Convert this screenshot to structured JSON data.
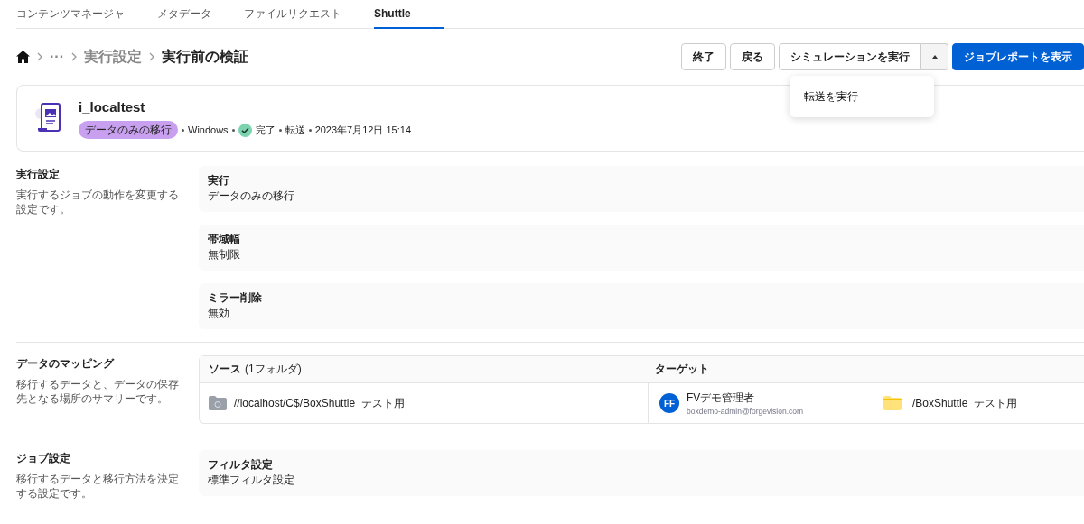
{
  "tabs": [
    {
      "label": "コンテンツマネージャ",
      "selected": false
    },
    {
      "label": "メタデータ",
      "selected": false
    },
    {
      "label": "ファイルリクエスト",
      "selected": false
    },
    {
      "label": "Shuttle",
      "selected": true
    }
  ],
  "breadcrumb": {
    "ellipsis": "···",
    "items": [
      "実行設定",
      "実行前の検証"
    ]
  },
  "actions": [
    {
      "label": "終了",
      "kind": "outline"
    },
    {
      "label": "戻る",
      "kind": "outline"
    },
    {
      "label": "シミュレーションを実行",
      "kind": "split"
    },
    {
      "label": "ジョブレポートを表示",
      "kind": "primary"
    }
  ],
  "dropdown": {
    "expanded": true,
    "items": [
      "転送を実行"
    ]
  },
  "job": {
    "name": "i_localtest",
    "tag": "データのみの移行",
    "os": "Windows",
    "status": "完了",
    "type": "転送",
    "date": "2023年7月12日 15:14"
  },
  "sections": [
    {
      "kind": "settings",
      "title": "実行設定",
      "description": "実行するジョブの動作を変更する設定です。",
      "items": [
        {
          "label": "実行",
          "value": "データのみの移行"
        },
        {
          "label": "帯域幅",
          "value": "無制限"
        },
        {
          "label": "ミラー削除",
          "value": "無効"
        }
      ]
    },
    {
      "kind": "mapping",
      "title": "データのマッピング",
      "description": "移行するデータと、データの保存先となる場所のサマリーです。",
      "source_header": "ソース",
      "source_count": "(1フォルダ)",
      "source_path": "//localhost/C$/BoxShuttle_テスト用",
      "target_header": "ターゲット",
      "user": {
        "initials": "FF",
        "name": "FVデモ管理者",
        "email": "boxdemo-admin@forgevision.com"
      },
      "target_path": "/BoxShuttle_テスト用"
    },
    {
      "kind": "settings",
      "title": "ジョブ設定",
      "description": "移行するデータと移行方法を決定する設定です。",
      "items": [
        {
          "label": "フィルタ設定",
          "value": "標準フィルタ設定"
        }
      ]
    }
  ]
}
